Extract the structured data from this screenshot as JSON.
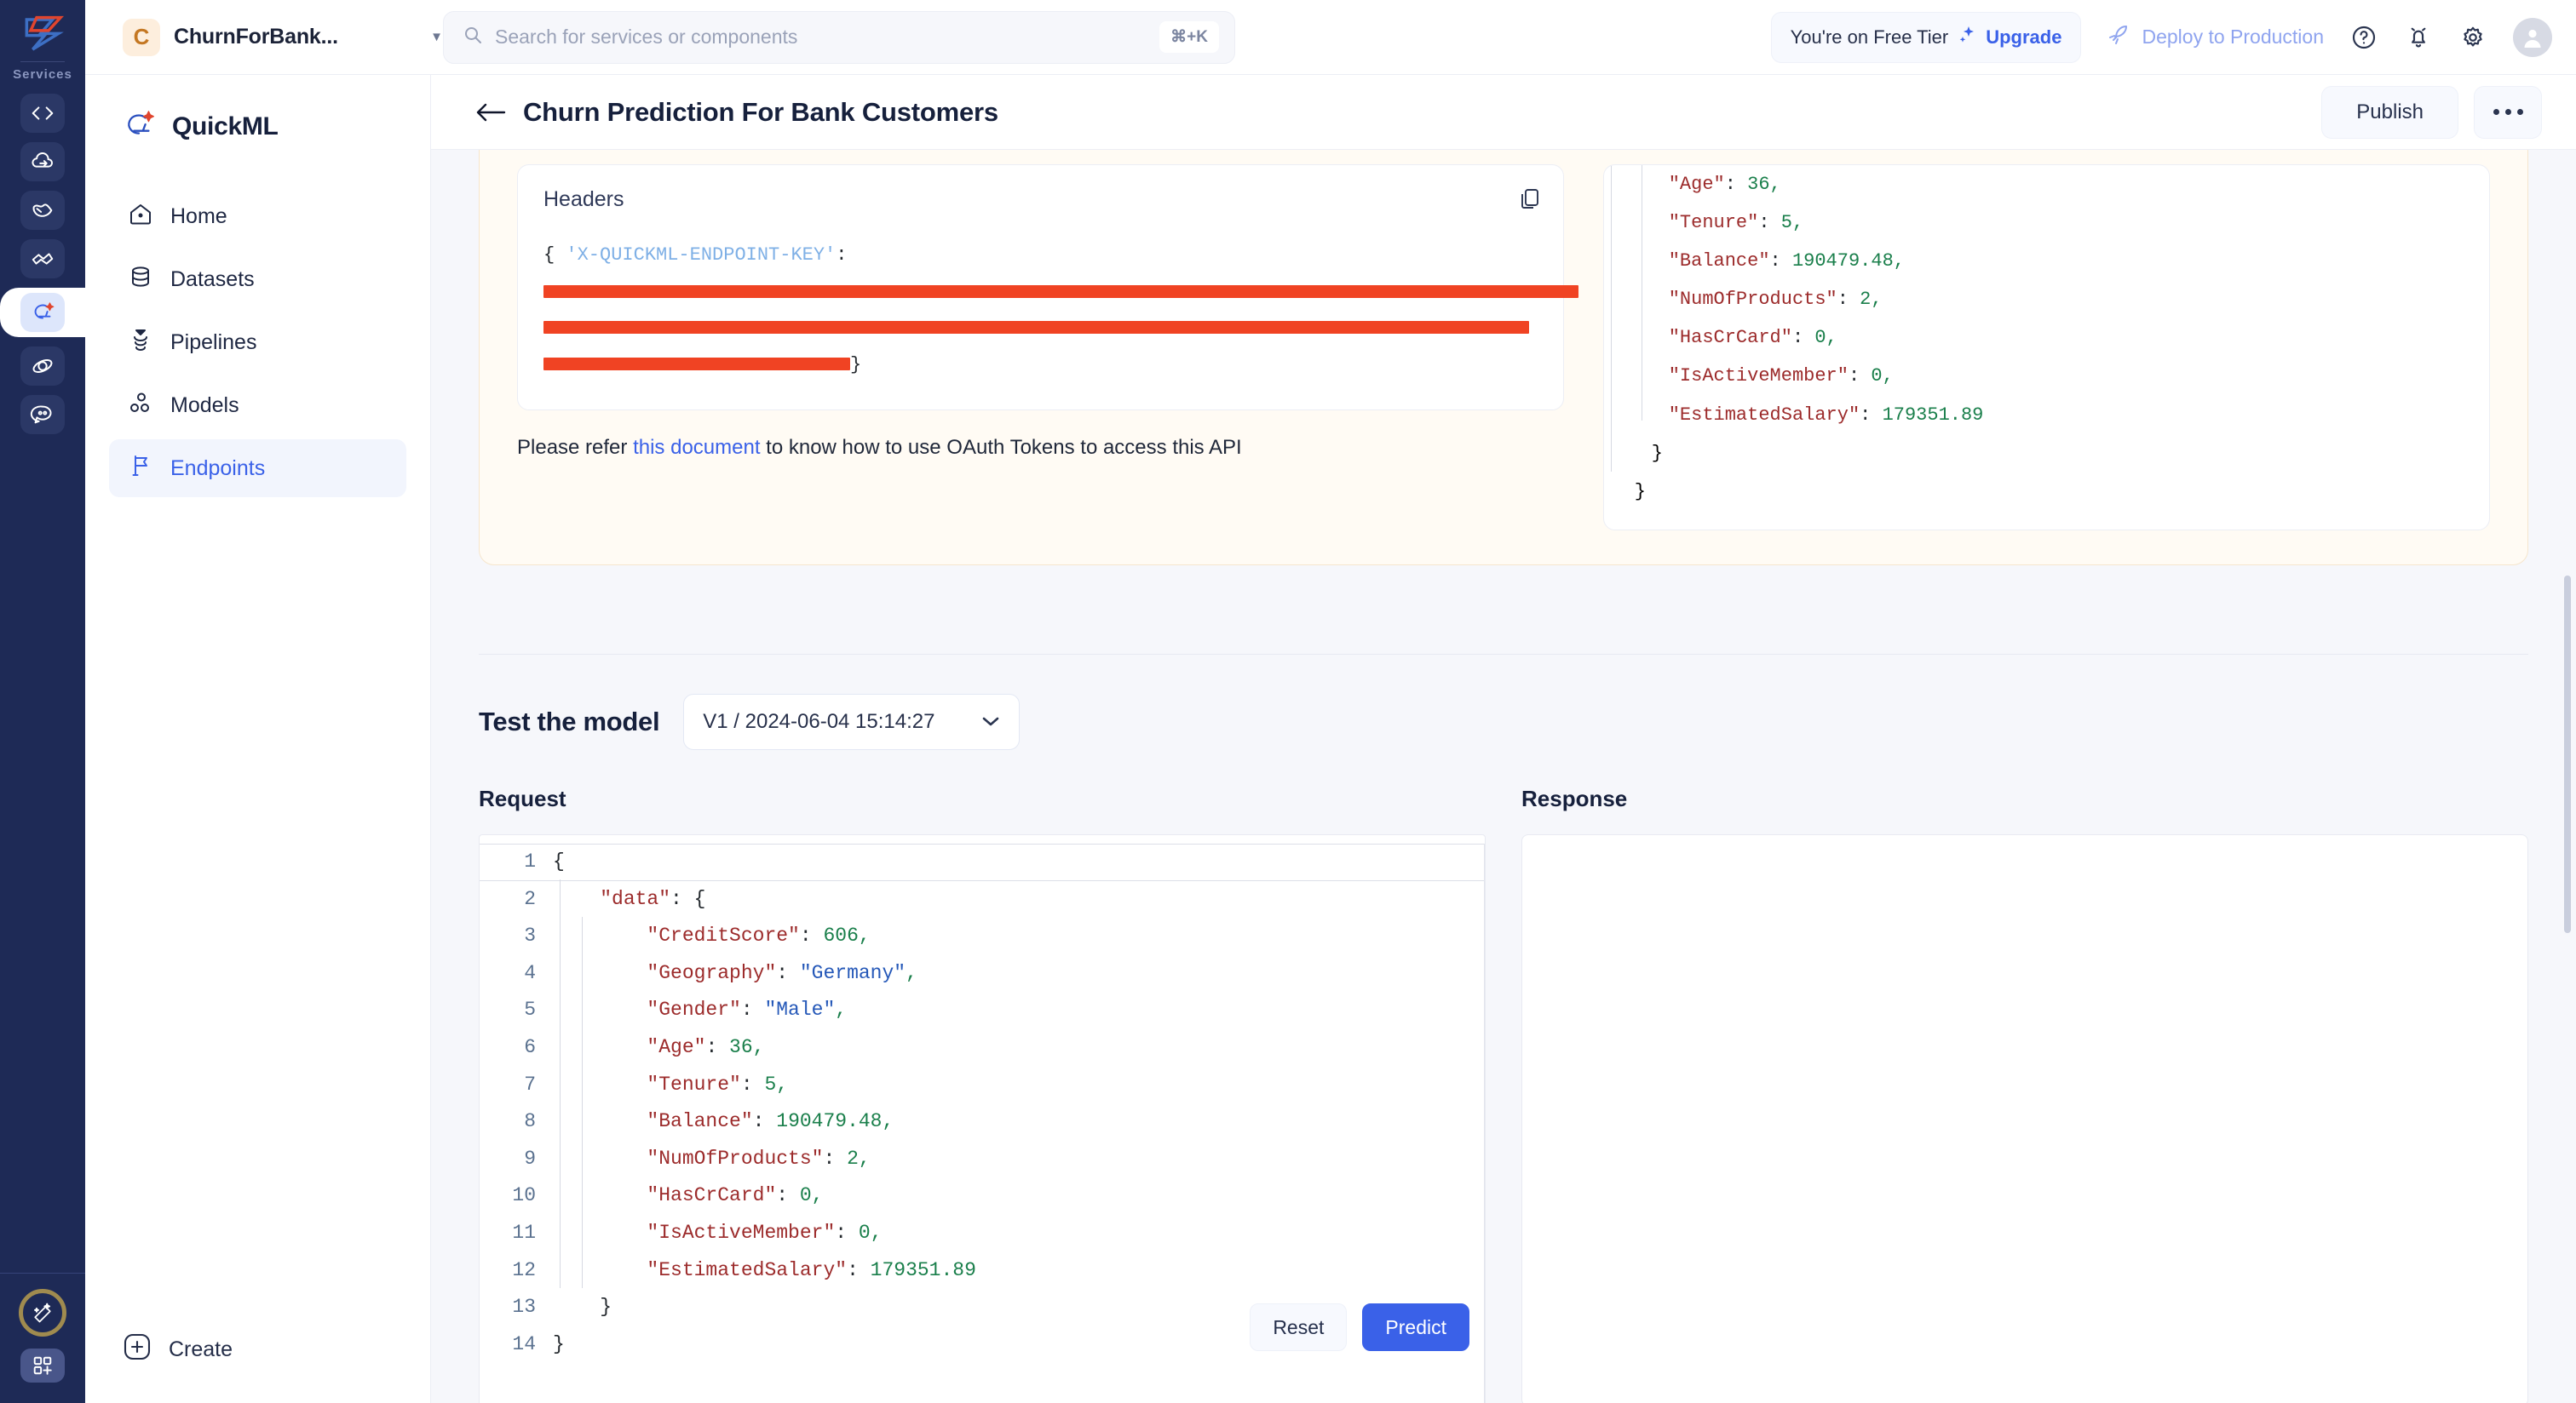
{
  "rail": {
    "label": "Services",
    "items": [
      {
        "name": "code-service-icon"
      },
      {
        "name": "cloud-deploy-icon"
      },
      {
        "name": "analytics-icon"
      },
      {
        "name": "integration-icon"
      },
      {
        "name": "quickml-icon"
      },
      {
        "name": "orbit-icon"
      },
      {
        "name": "chat-bot-icon"
      }
    ],
    "bottom": [
      {
        "name": "magic-wand-icon"
      },
      {
        "name": "app-grid-plus-icon"
      }
    ]
  },
  "topbar": {
    "workspace_initial": "C",
    "workspace_name": "ChurnForBank...",
    "workspace_caret": "▼",
    "search": {
      "placeholder": "Search for services or components",
      "shortcut": "⌘+K"
    },
    "tier_text": "You're on Free Tier",
    "upgrade_label": "Upgrade",
    "deploy_label": "Deploy to Production"
  },
  "sidebar": {
    "brand": "QuickML",
    "items": [
      {
        "label": "Home",
        "icon": "home-icon",
        "active": false
      },
      {
        "label": "Datasets",
        "icon": "database-icon",
        "active": false
      },
      {
        "label": "Pipelines",
        "icon": "pipeline-icon",
        "active": false
      },
      {
        "label": "Models",
        "icon": "models-icon",
        "active": false
      },
      {
        "label": "Endpoints",
        "icon": "flag-icon",
        "active": true
      }
    ],
    "create_label": "Create"
  },
  "page": {
    "title": "Churn Prediction For Bank Customers",
    "publish_label": "Publish",
    "more_label": "···"
  },
  "auth_card": {
    "headers_title": "Headers",
    "code_open_brace": "{",
    "code_key": "'X-QUICKML-ENDPOINT-KEY'",
    "code_colon": ":",
    "code_close_brace": "}",
    "redacted_line_1": "",
    "redacted_line_2": "",
    "redacted_line_3": "",
    "hint_prefix": "Please refer ",
    "hint_link": "this document",
    "hint_suffix": " to know how to use OAuth Tokens to access this API"
  },
  "response_preview": {
    "lines": [
      {
        "key": "\"Age\"",
        "value": "36",
        "type": "num",
        "comma": ",",
        "indent": 2
      },
      {
        "key": "\"Tenure\"",
        "value": "5",
        "type": "num",
        "comma": ",",
        "indent": 2
      },
      {
        "key": "\"Balance\"",
        "value": "190479.48",
        "type": "num",
        "comma": ",",
        "indent": 2
      },
      {
        "key": "\"NumOfProducts\"",
        "value": "2",
        "type": "num",
        "comma": ",",
        "indent": 2
      },
      {
        "key": "\"HasCrCard\"",
        "value": "0",
        "type": "num",
        "comma": ",",
        "indent": 2
      },
      {
        "key": "\"IsActiveMember\"",
        "value": "0",
        "type": "num",
        "comma": ",",
        "indent": 2
      },
      {
        "key": "\"EstimatedSalary\"",
        "value": "179351.89",
        "type": "num",
        "comma": "",
        "indent": 2
      }
    ],
    "close_inner": "}",
    "close_outer": "}"
  },
  "test_section": {
    "title": "Test the model",
    "version_selected": "V1 / 2024-06-04 15:14:27",
    "request_label": "Request",
    "response_label": "Response",
    "reset_label": "Reset",
    "predict_label": "Predict",
    "request_editor": {
      "line_numbers": [
        "1",
        "2",
        "3",
        "4",
        "5",
        "6",
        "7",
        "8",
        "9",
        "10",
        "11",
        "12",
        "13",
        "14"
      ],
      "lines": [
        {
          "n": 1,
          "raw": "{",
          "kind": "punct"
        },
        {
          "n": 2,
          "raw": "    \"data\": {",
          "kind": "objkey",
          "key": "\"data\"",
          "after": ": {",
          "indent": 1
        },
        {
          "n": 3,
          "raw": "        \"CreditScore\": 606,",
          "kind": "kv",
          "key": "\"CreditScore\"",
          "value": "606",
          "type": "num",
          "comma": ",",
          "indent": 2
        },
        {
          "n": 4,
          "raw": "        \"Geography\": \"Germany\",",
          "kind": "kv",
          "key": "\"Geography\"",
          "value": "\"Germany\"",
          "type": "str",
          "comma": ",",
          "indent": 2
        },
        {
          "n": 5,
          "raw": "        \"Gender\": \"Male\",",
          "kind": "kv",
          "key": "\"Gender\"",
          "value": "\"Male\"",
          "type": "str",
          "comma": ",",
          "indent": 2
        },
        {
          "n": 6,
          "raw": "        \"Age\": 36,",
          "kind": "kv",
          "key": "\"Age\"",
          "value": "36",
          "type": "num",
          "comma": ",",
          "indent": 2
        },
        {
          "n": 7,
          "raw": "        \"Tenure\": 5,",
          "kind": "kv",
          "key": "\"Tenure\"",
          "value": "5",
          "type": "num",
          "comma": ",",
          "indent": 2
        },
        {
          "n": 8,
          "raw": "        \"Balance\": 190479.48,",
          "kind": "kv",
          "key": "\"Balance\"",
          "value": "190479.48",
          "type": "num",
          "comma": ",",
          "indent": 2
        },
        {
          "n": 9,
          "raw": "        \"NumOfProducts\": 2,",
          "kind": "kv",
          "key": "\"NumOfProducts\"",
          "value": "2",
          "type": "num",
          "comma": ",",
          "indent": 2
        },
        {
          "n": 10,
          "raw": "        \"HasCrCard\": 0,",
          "kind": "kv",
          "key": "\"HasCrCard\"",
          "value": "0",
          "type": "num",
          "comma": ",",
          "indent": 2
        },
        {
          "n": 11,
          "raw": "        \"IsActiveMember\": 0,",
          "kind": "kv",
          "key": "\"IsActiveMember\"",
          "value": "0",
          "type": "num",
          "comma": ",",
          "indent": 2
        },
        {
          "n": 12,
          "raw": "        \"EstimatedSalary\": 179351.89",
          "kind": "kv",
          "key": "\"EstimatedSalary\"",
          "value": "179351.89",
          "type": "num",
          "comma": "",
          "indent": 2
        },
        {
          "n": 13,
          "raw": "    }",
          "kind": "punct"
        },
        {
          "n": 14,
          "raw": "}",
          "kind": "punct"
        }
      ]
    },
    "response_body": ""
  },
  "colors": {
    "accent_blue": "#3a61e8",
    "rail_navy": "#1e2a56",
    "redact_red": "#f04323",
    "card_yellow": "#fffbf4",
    "json_key_red": "#9c2b2b",
    "json_num_green": "#1a7f4b",
    "json_str_blue": "#2558b8",
    "gold_ring": "#a08b4f"
  }
}
